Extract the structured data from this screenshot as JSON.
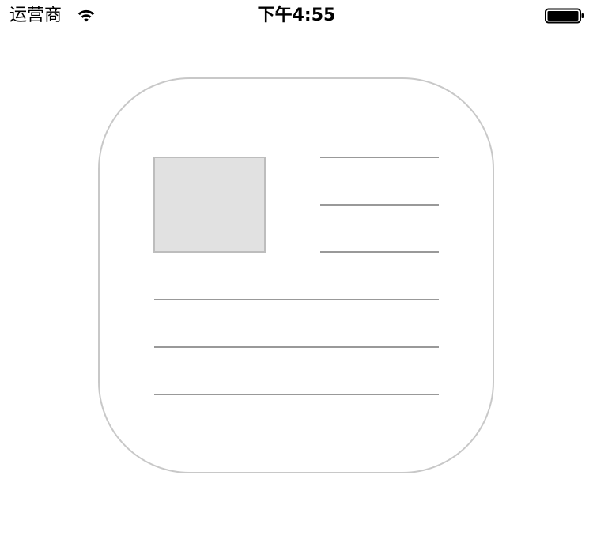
{
  "status_bar": {
    "carrier": "运营商",
    "time": "下午4:55",
    "wifi_icon": "wifi-icon",
    "battery_icon": "battery-icon",
    "battery_level": 1.0
  },
  "placeholder": {
    "icon": "news-placeholder-icon",
    "stroke_color": "#c8c8c8",
    "line_color": "#999999",
    "image_fill": "#e1e1e1"
  }
}
